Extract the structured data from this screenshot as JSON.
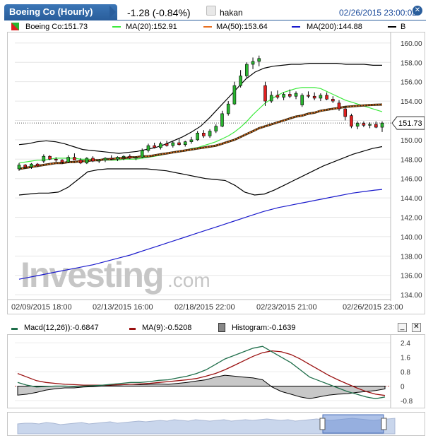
{
  "header": {
    "tab_title": "Boeing Co (Hourly)",
    "change": "-1.28 (-0.84%)",
    "user": "hakan",
    "timestamp": "02/26/2015 23:00:02"
  },
  "legend": {
    "symbol": "Boeing Co:151.73",
    "ma20": "MA(20):152.91",
    "ma50": "MA(50):153.64",
    "ma200": "MA(200):144.88",
    "extra": "B"
  },
  "price_tag": "151.73",
  "watermark": {
    "main": "Investing",
    "suffix": ".com"
  },
  "macd_legend": {
    "macd": "Macd(12,26)):-0.6847",
    "signal": "MA(9):-0.5208",
    "histogram": "Histogram:-0.1639"
  },
  "colors": {
    "up": "#2ab530",
    "down": "#e02020",
    "ma20": "#3dea3d",
    "ma50": "#e87020",
    "ma200": "#1a1acc",
    "bands": "#000000",
    "macd": "#1f6e4a",
    "signal": "#9a1010",
    "header": "#2a5e9c"
  },
  "chart_data": [
    {
      "type": "candlestick",
      "title": "Boeing Co (Hourly)",
      "y_ticks": [
        134,
        136,
        138,
        140,
        142,
        144,
        146,
        148,
        150,
        152,
        154,
        156,
        158,
        160
      ],
      "ylim": [
        133.5,
        160.5
      ],
      "x_labels": [
        "02/09/2015 18:00",
        "02/13/2015 16:00",
        "02/18/2015 22:00",
        "02/23/2015 21:00",
        "02/26/2015 23:00"
      ],
      "last_price": 151.73,
      "candles": [
        [
          147.0,
          147.6,
          146.8,
          147.4
        ],
        [
          147.4,
          147.5,
          147.0,
          147.2
        ],
        [
          147.2,
          147.6,
          147.0,
          147.5
        ],
        [
          147.5,
          147.6,
          147.2,
          147.3
        ],
        [
          147.8,
          148.5,
          147.6,
          148.3
        ],
        [
          148.3,
          148.4,
          147.9,
          148.0
        ],
        [
          148.0,
          148.2,
          147.7,
          147.9
        ],
        [
          147.9,
          148.0,
          147.5,
          147.7
        ],
        [
          147.7,
          148.4,
          147.6,
          148.2
        ],
        [
          148.2,
          148.6,
          147.9,
          147.9
        ],
        [
          147.9,
          148.1,
          147.5,
          147.6
        ],
        [
          147.6,
          148.2,
          147.5,
          148.1
        ],
        [
          148.1,
          148.3,
          147.7,
          147.8
        ],
        [
          147.8,
          148.0,
          147.6,
          147.9
        ],
        [
          147.9,
          148.2,
          147.7,
          148.1
        ],
        [
          148.1,
          148.4,
          147.9,
          148.0
        ],
        [
          148.0,
          148.3,
          147.8,
          148.2
        ],
        [
          148.2,
          148.4,
          147.9,
          148.3
        ],
        [
          148.3,
          148.5,
          148.0,
          148.1
        ],
        [
          148.1,
          148.3,
          147.9,
          148.2
        ],
        [
          148.2,
          149.1,
          148.1,
          148.9
        ],
        [
          148.9,
          149.6,
          148.7,
          149.4
        ],
        [
          149.4,
          149.7,
          149.1,
          149.2
        ],
        [
          149.2,
          149.8,
          149.0,
          149.6
        ],
        [
          149.6,
          149.9,
          149.3,
          149.4
        ],
        [
          149.4,
          149.9,
          149.2,
          149.7
        ],
        [
          149.7,
          150.1,
          149.4,
          149.5
        ],
        [
          149.5,
          149.9,
          149.3,
          149.8
        ],
        [
          149.8,
          150.3,
          149.6,
          150.0
        ],
        [
          150.0,
          150.9,
          149.9,
          150.7
        ],
        [
          150.7,
          151.0,
          150.2,
          150.4
        ],
        [
          150.4,
          151.1,
          150.2,
          150.9
        ],
        [
          150.9,
          151.6,
          150.7,
          151.4
        ],
        [
          151.4,
          153.0,
          151.3,
          152.7
        ],
        [
          152.7,
          154.0,
          152.5,
          153.7
        ],
        [
          153.7,
          156.0,
          153.6,
          155.6
        ],
        [
          155.6,
          157.2,
          155.4,
          156.6
        ],
        [
          156.6,
          158.0,
          156.4,
          157.8
        ],
        [
          157.8,
          158.5,
          157.3,
          158.1
        ],
        [
          158.1,
          158.7,
          157.6,
          158.4
        ],
        [
          155.6,
          156.0,
          153.5,
          154.0
        ],
        [
          154.0,
          155.0,
          153.8,
          154.6
        ],
        [
          154.6,
          155.1,
          154.2,
          154.4
        ],
        [
          154.4,
          154.9,
          154.1,
          154.7
        ],
        [
          154.7,
          155.2,
          154.3,
          154.5
        ],
        [
          154.5,
          155.0,
          154.2,
          154.8
        ],
        [
          153.6,
          154.8,
          153.4,
          154.6
        ],
        [
          154.6,
          155.0,
          154.3,
          154.5
        ],
        [
          154.5,
          154.9,
          154.1,
          154.3
        ],
        [
          154.3,
          154.8,
          154.0,
          154.6
        ],
        [
          154.6,
          154.9,
          154.1,
          154.2
        ],
        [
          154.2,
          154.5,
          153.8,
          154.0
        ],
        [
          153.8,
          154.1,
          153.0,
          153.2
        ],
        [
          153.2,
          153.5,
          152.0,
          152.4
        ],
        [
          152.5,
          152.7,
          151.2,
          151.4
        ],
        [
          151.4,
          151.9,
          151.1,
          151.7
        ],
        [
          151.7,
          151.9,
          151.3,
          151.5
        ],
        [
          151.5,
          151.8,
          151.2,
          151.6
        ],
        [
          151.6,
          151.9,
          151.2,
          151.3
        ],
        [
          151.3,
          151.9,
          150.8,
          151.73
        ]
      ],
      "series": [
        {
          "name": "MA(20)",
          "values": [
            147.6,
            147.7,
            147.8,
            147.9,
            147.9,
            148.0,
            148.1,
            148.1,
            148.1,
            148.1,
            148.0,
            148.0,
            148.0,
            147.9,
            147.9,
            147.9,
            147.9,
            148.0,
            148.0,
            148.0,
            148.1,
            148.2,
            148.3,
            148.4,
            148.6,
            148.7,
            148.8,
            148.9,
            149.1,
            149.2,
            149.4,
            149.6,
            149.8,
            150.1,
            150.4,
            150.8,
            151.3,
            151.9,
            152.6,
            153.2,
            153.8,
            154.2,
            154.6,
            154.9,
            155.1,
            155.3,
            155.4,
            155.4,
            155.4,
            155.3,
            155.0,
            154.7,
            154.4,
            154.1,
            153.9,
            153.7,
            153.5,
            153.3,
            153.1,
            152.9
          ]
        },
        {
          "name": "MA(50)",
          "values": [
            147.0,
            147.1,
            147.2,
            147.3,
            147.4,
            147.5,
            147.6,
            147.6,
            147.7,
            147.7,
            147.8,
            147.8,
            147.9,
            147.9,
            148.0,
            148.0,
            148.1,
            148.1,
            148.2,
            148.2,
            148.3,
            148.3,
            148.4,
            148.5,
            148.6,
            148.7,
            148.8,
            148.9,
            149.0,
            149.1,
            149.2,
            149.3,
            149.4,
            149.6,
            149.8,
            150.0,
            150.3,
            150.6,
            150.9,
            151.2,
            151.4,
            151.6,
            151.8,
            152.0,
            152.2,
            152.4,
            152.5,
            152.7,
            152.8,
            153.0,
            153.1,
            153.2,
            153.3,
            153.4,
            153.45,
            153.5,
            153.55,
            153.6,
            153.62,
            153.64
          ]
        },
        {
          "name": "MA(200)",
          "values": [
            135.6,
            135.75,
            135.9,
            136.05,
            136.2,
            136.35,
            136.5,
            136.65,
            136.8,
            136.95,
            137.1,
            137.3,
            137.5,
            137.7,
            137.9,
            138.1,
            138.35,
            138.6,
            138.85,
            139.1,
            139.35,
            139.6,
            139.85,
            140.1,
            140.35,
            140.6,
            140.85,
            141.1,
            141.35,
            141.6,
            141.85,
            142.1,
            142.35,
            142.6,
            142.8,
            143.0,
            143.15,
            143.3,
            143.45,
            143.6,
            143.75,
            143.9,
            144.05,
            144.2,
            144.35,
            144.5,
            144.6,
            144.7,
            144.8,
            144.88
          ]
        },
        {
          "name": "Upper band",
          "values": [
            149.5,
            149.6,
            149.8,
            149.9,
            149.8,
            149.6,
            149.3,
            149.0,
            148.9,
            148.8,
            148.7,
            148.6,
            148.7,
            148.8,
            149.0,
            149.2,
            149.5,
            149.9,
            150.3,
            150.8,
            151.4,
            152.3,
            153.3,
            154.3,
            155.3,
            156.3,
            157.0,
            157.4,
            157.6,
            157.7,
            157.8,
            157.8,
            157.9,
            157.9,
            157.9,
            157.9,
            157.8,
            157.8,
            157.8,
            157.7,
            157.7
          ]
        },
        {
          "name": "Lower band",
          "values": [
            144.3,
            144.4,
            144.5,
            144.5,
            144.6,
            145.1,
            145.9,
            146.7,
            146.9,
            147.0,
            147.0,
            147.0,
            147.0,
            147.0,
            146.9,
            146.8,
            146.6,
            146.4,
            146.2,
            146.0,
            145.9,
            145.8,
            145.3,
            144.6,
            144.3,
            144.4,
            144.8,
            145.3,
            145.8,
            146.3,
            146.8,
            147.3,
            147.7,
            148.1,
            148.5,
            148.8,
            149.1,
            149.3
          ]
        }
      ]
    },
    {
      "type": "line",
      "title": "MACD",
      "y_ticks": [
        -0.8,
        0,
        0.8,
        1.6,
        2.4
      ],
      "ylim": [
        -1.0,
        2.6
      ],
      "series": [
        {
          "name": "Macd(12,26))",
          "values": [
            0.2,
            0.05,
            -0.05,
            -0.02,
            0.0,
            0.0,
            -0.02,
            0.0,
            0.02,
            0.05,
            0.1,
            0.15,
            0.2,
            0.2,
            0.25,
            0.32,
            0.35,
            0.45,
            0.55,
            0.7,
            0.9,
            1.2,
            1.5,
            1.7,
            1.9,
            2.1,
            2.2,
            1.9,
            1.6,
            1.3,
            0.9,
            0.5,
            0.3,
            0.1,
            -0.1,
            -0.3,
            -0.45,
            -0.6,
            -0.7,
            -0.6
          ]
        },
        {
          "name": "MA(9)",
          "values": [
            0.7,
            0.5,
            0.3,
            0.2,
            0.15,
            0.1,
            0.08,
            0.05,
            0.05,
            0.05,
            0.06,
            0.08,
            0.1,
            0.12,
            0.15,
            0.2,
            0.25,
            0.3,
            0.35,
            0.42,
            0.55,
            0.7,
            0.9,
            1.15,
            1.4,
            1.65,
            1.85,
            1.95,
            1.9,
            1.75,
            1.5,
            1.2,
            0.9,
            0.6,
            0.35,
            0.12,
            -0.1,
            -0.3,
            -0.45,
            -0.52
          ]
        },
        {
          "name": "Histogram",
          "values": [
            -0.5,
            -0.45,
            -0.35,
            -0.22,
            -0.15,
            -0.1,
            -0.1,
            -0.05,
            -0.03,
            0.0,
            0.04,
            0.07,
            0.1,
            0.08,
            0.1,
            0.12,
            0.1,
            0.15,
            0.2,
            0.28,
            0.35,
            0.5,
            0.6,
            0.55,
            0.5,
            0.45,
            0.35,
            -0.05,
            -0.3,
            -0.45,
            -0.6,
            -0.7,
            -0.6,
            -0.5,
            -0.45,
            -0.42,
            -0.35,
            -0.3,
            -0.25,
            -0.16
          ]
        }
      ]
    }
  ]
}
